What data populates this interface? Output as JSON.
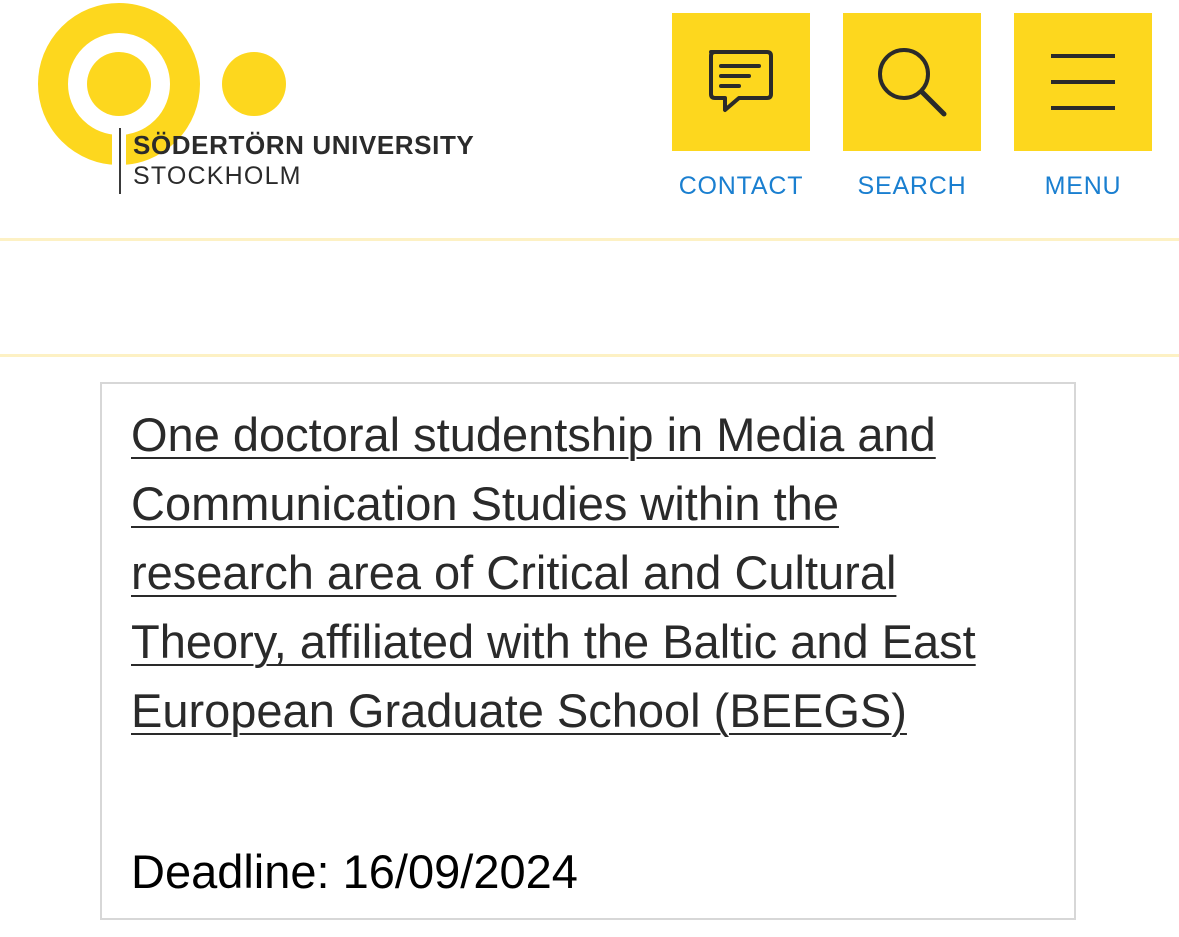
{
  "header": {
    "logo": {
      "name": "SÖDERTÖRN UNIVERSITY",
      "city": "STOCKHOLM"
    },
    "nav": [
      {
        "label": "CONTACT",
        "icon": "chat-icon"
      },
      {
        "label": "SEARCH",
        "icon": "search-icon"
      },
      {
        "label": "MENU",
        "icon": "hamburger-icon"
      }
    ]
  },
  "card": {
    "title": "One doctoral studentship in Media and Communication Studies within the research area of Critical and Cultural Theory, affiliated with the Baltic and East European Graduate School (BEEGS)",
    "deadline_label": "Deadline:",
    "deadline_date": "16/09/2024"
  },
  "colors": {
    "brand_yellow": "#fdd71e",
    "link_blue": "#1a7fd0",
    "rule": "#fdf1c4",
    "card_border": "#d7d7d7"
  }
}
